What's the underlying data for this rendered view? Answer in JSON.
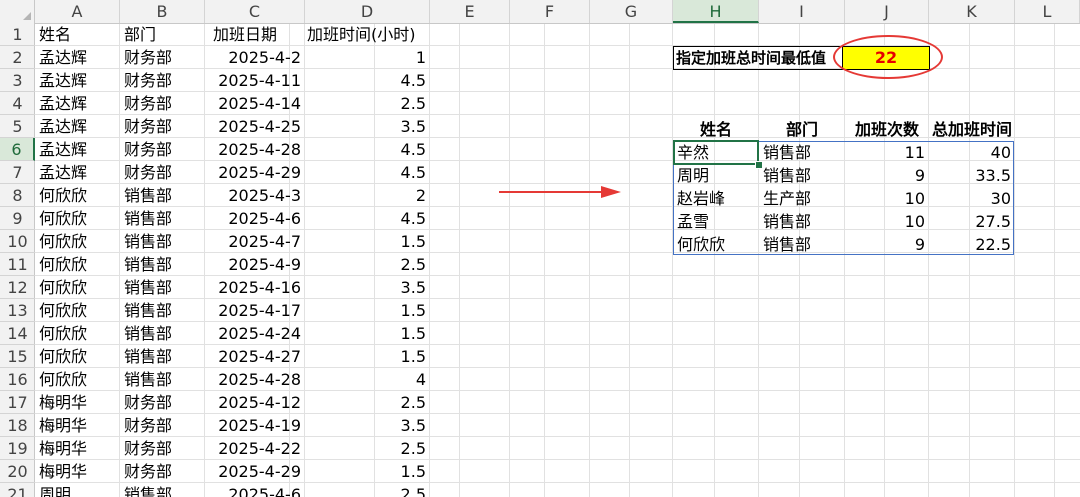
{
  "columns": [
    "A",
    "B",
    "C",
    "D",
    "E",
    "F",
    "G",
    "H",
    "I",
    "J",
    "K",
    "L"
  ],
  "selected_column": "H",
  "rows": [
    "1",
    "2",
    "3",
    "4",
    "5",
    "6",
    "7",
    "8",
    "9",
    "10",
    "11",
    "12",
    "13",
    "14",
    "15",
    "16",
    "17",
    "18",
    "19",
    "20",
    "21"
  ],
  "selected_row": "6",
  "headers": {
    "name": "姓名",
    "dept": "部门",
    "date": "加班日期",
    "hours": "加班时间(小时)"
  },
  "records": [
    {
      "name": "孟达辉",
      "dept": "财务部",
      "date": "2025-4-2",
      "hours": "1"
    },
    {
      "name": "孟达辉",
      "dept": "财务部",
      "date": "2025-4-11",
      "hours": "4.5"
    },
    {
      "name": "孟达辉",
      "dept": "财务部",
      "date": "2025-4-14",
      "hours": "2.5"
    },
    {
      "name": "孟达辉",
      "dept": "财务部",
      "date": "2025-4-25",
      "hours": "3.5"
    },
    {
      "name": "孟达辉",
      "dept": "财务部",
      "date": "2025-4-28",
      "hours": "4.5"
    },
    {
      "name": "孟达辉",
      "dept": "财务部",
      "date": "2025-4-29",
      "hours": "4.5"
    },
    {
      "name": "何欣欣",
      "dept": "销售部",
      "date": "2025-4-3",
      "hours": "2"
    },
    {
      "name": "何欣欣",
      "dept": "销售部",
      "date": "2025-4-6",
      "hours": "4.5"
    },
    {
      "name": "何欣欣",
      "dept": "销售部",
      "date": "2025-4-7",
      "hours": "1.5"
    },
    {
      "name": "何欣欣",
      "dept": "销售部",
      "date": "2025-4-9",
      "hours": "2.5"
    },
    {
      "name": "何欣欣",
      "dept": "销售部",
      "date": "2025-4-16",
      "hours": "3.5"
    },
    {
      "name": "何欣欣",
      "dept": "销售部",
      "date": "2025-4-17",
      "hours": "1.5"
    },
    {
      "name": "何欣欣",
      "dept": "销售部",
      "date": "2025-4-24",
      "hours": "1.5"
    },
    {
      "name": "何欣欣",
      "dept": "销售部",
      "date": "2025-4-27",
      "hours": "1.5"
    },
    {
      "name": "何欣欣",
      "dept": "销售部",
      "date": "2025-4-28",
      "hours": "4"
    },
    {
      "name": "梅明华",
      "dept": "财务部",
      "date": "2025-4-12",
      "hours": "2.5"
    },
    {
      "name": "梅明华",
      "dept": "财务部",
      "date": "2025-4-19",
      "hours": "3.5"
    },
    {
      "name": "梅明华",
      "dept": "财务部",
      "date": "2025-4-22",
      "hours": "2.5"
    },
    {
      "name": "梅明华",
      "dept": "财务部",
      "date": "2025-4-29",
      "hours": "1.5"
    },
    {
      "name": "周明",
      "dept": "销售部",
      "date": "2025-4-6",
      "hours": "2.5"
    }
  ],
  "parameter": {
    "label": "指定加班总时间最低值",
    "value": "22"
  },
  "result_headers": {
    "name": "姓名",
    "dept": "部门",
    "count": "加班次数",
    "total": "总加班时间"
  },
  "results": [
    {
      "name": "辛然",
      "dept": "销售部",
      "count": "11",
      "total": "40"
    },
    {
      "name": "周明",
      "dept": "销售部",
      "count": "9",
      "total": "33.5"
    },
    {
      "name": "赵岩峰",
      "dept": "生产部",
      "count": "10",
      "total": "30"
    },
    {
      "name": "孟雪",
      "dept": "销售部",
      "count": "10",
      "total": "27.5"
    },
    {
      "name": "何欣欣",
      "dept": "销售部",
      "count": "9",
      "total": "22.5"
    }
  ],
  "colors": {
    "highlight_fill": "#ffff00",
    "highlight_text": "#e60000",
    "annotation": "#e53935",
    "selection": "#217346",
    "result_border": "#4472c4"
  }
}
